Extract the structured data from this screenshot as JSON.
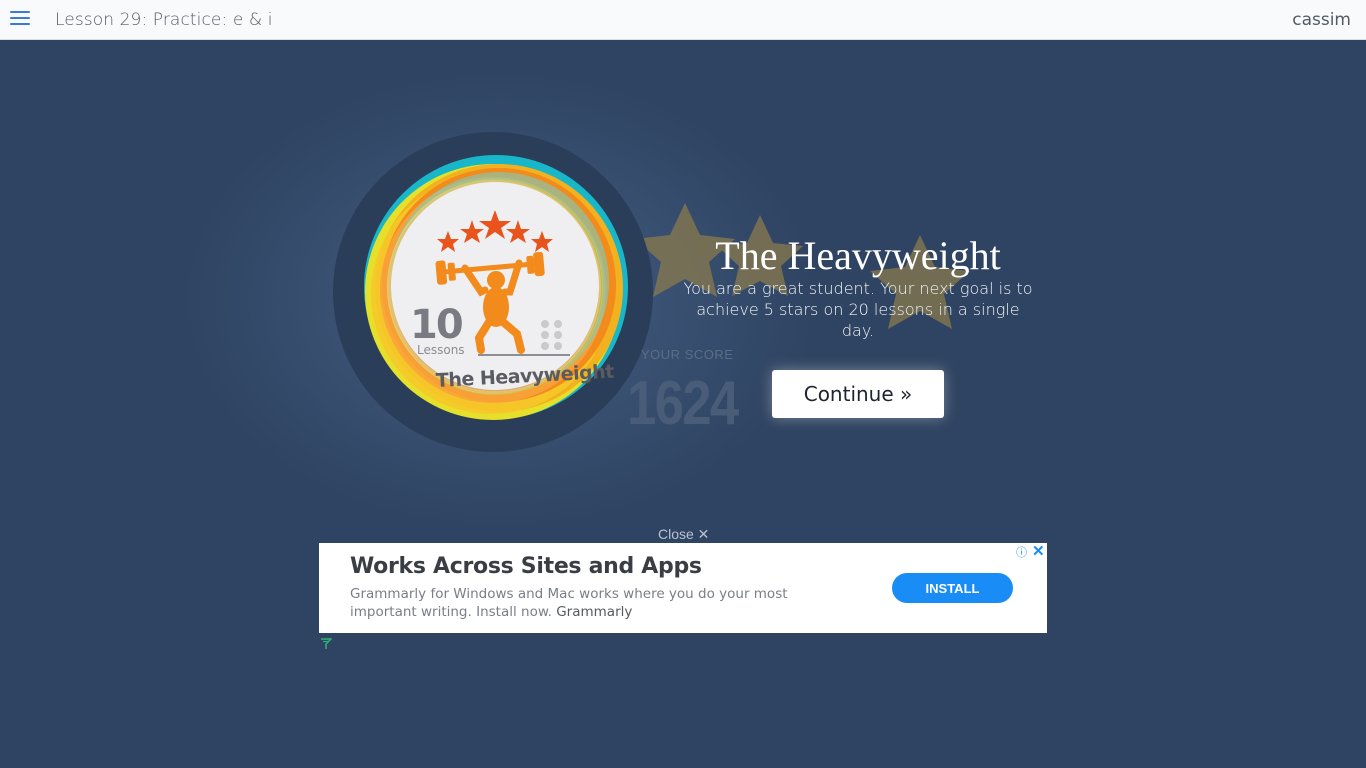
{
  "header": {
    "lesson_title": "Lesson 29: Practice: e & i",
    "username": "cassim"
  },
  "badge": {
    "count": "10",
    "count_label": "Lessons",
    "name": "The Heavyweight"
  },
  "achievement": {
    "title": "The Heavyweight",
    "description": "You are a great student. Your next goal is to achieve 5 stars on 20 lessons in a single day.",
    "continue_label": "Continue »"
  },
  "score": {
    "label": "YOUR SCORE",
    "value": "1624"
  },
  "ad": {
    "close_label": "Close ✕",
    "headline": "Works Across Sites and Apps",
    "body": "Grammarly for Windows and Mac works where you do your most important writing. Install now.",
    "brand": "Grammarly",
    "install_label": "INSTALL",
    "info_glyph": "ⓘ",
    "x_glyph": "✕"
  },
  "colors": {
    "background": "#2f4462",
    "accent": "#3a7bd5",
    "install": "#1a8cf5",
    "badge_orange": "#f28a1c"
  }
}
